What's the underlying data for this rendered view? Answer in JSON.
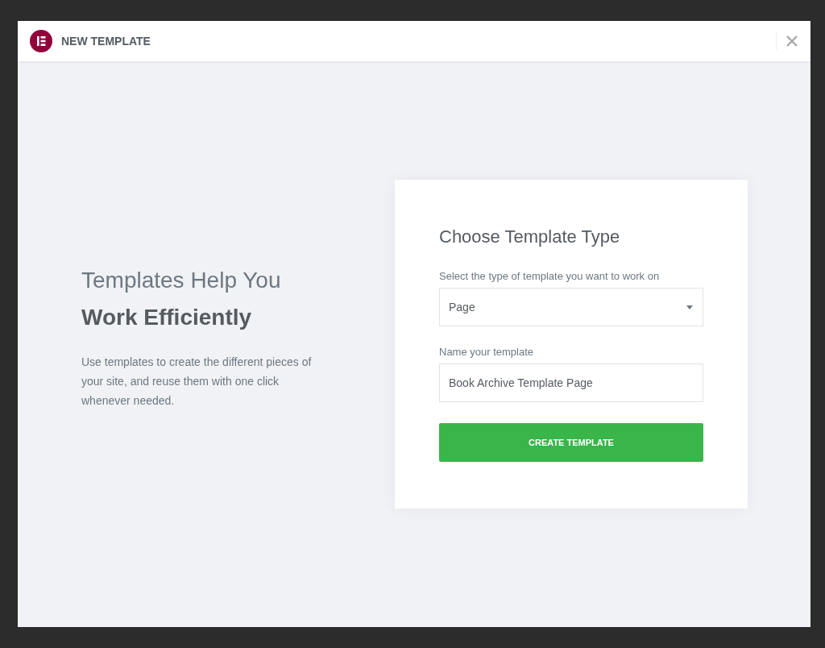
{
  "window": {
    "title": "NEW TEMPLATE"
  },
  "intro": {
    "heading": "Templates Help You **Work Efficiently**",
    "text": "Use templates to create the different pieces of your site, and reuse them with one click whenever needed."
  },
  "form": {
    "title": "Choose Template Type",
    "type_label": "Select the type of template you want to work on",
    "type_value": "Page",
    "name_label": "Name your template",
    "name_value": "Book Archive Template Page",
    "submit": "CREATE TEMPLATE"
  }
}
